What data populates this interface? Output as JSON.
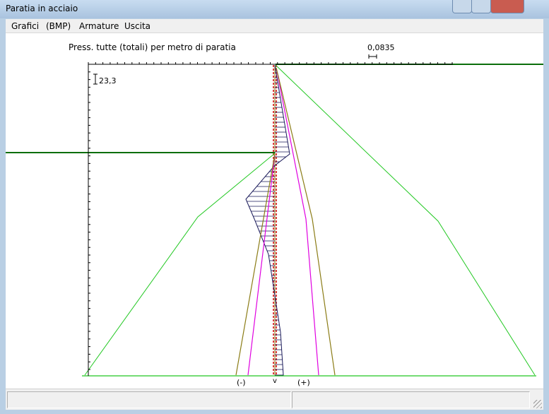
{
  "window": {
    "title": "Paratia in acciaio"
  },
  "menu": {
    "items": [
      "Grafici",
      "(BMP)",
      "Armature",
      "Uscita"
    ]
  },
  "plot": {
    "title": "Press. tutte (totali) per metro di paratia",
    "scale_top": "0,0835",
    "scale_left": "23,3",
    "label_neg": "(-)",
    "label_axis": "v",
    "label_pos": "(+)"
  },
  "colors": {
    "green": "#22c822",
    "dark_green": "#0b6e0b",
    "olive": "#8b7c16",
    "magenta": "#e000e0",
    "red": "#d00000"
  }
}
